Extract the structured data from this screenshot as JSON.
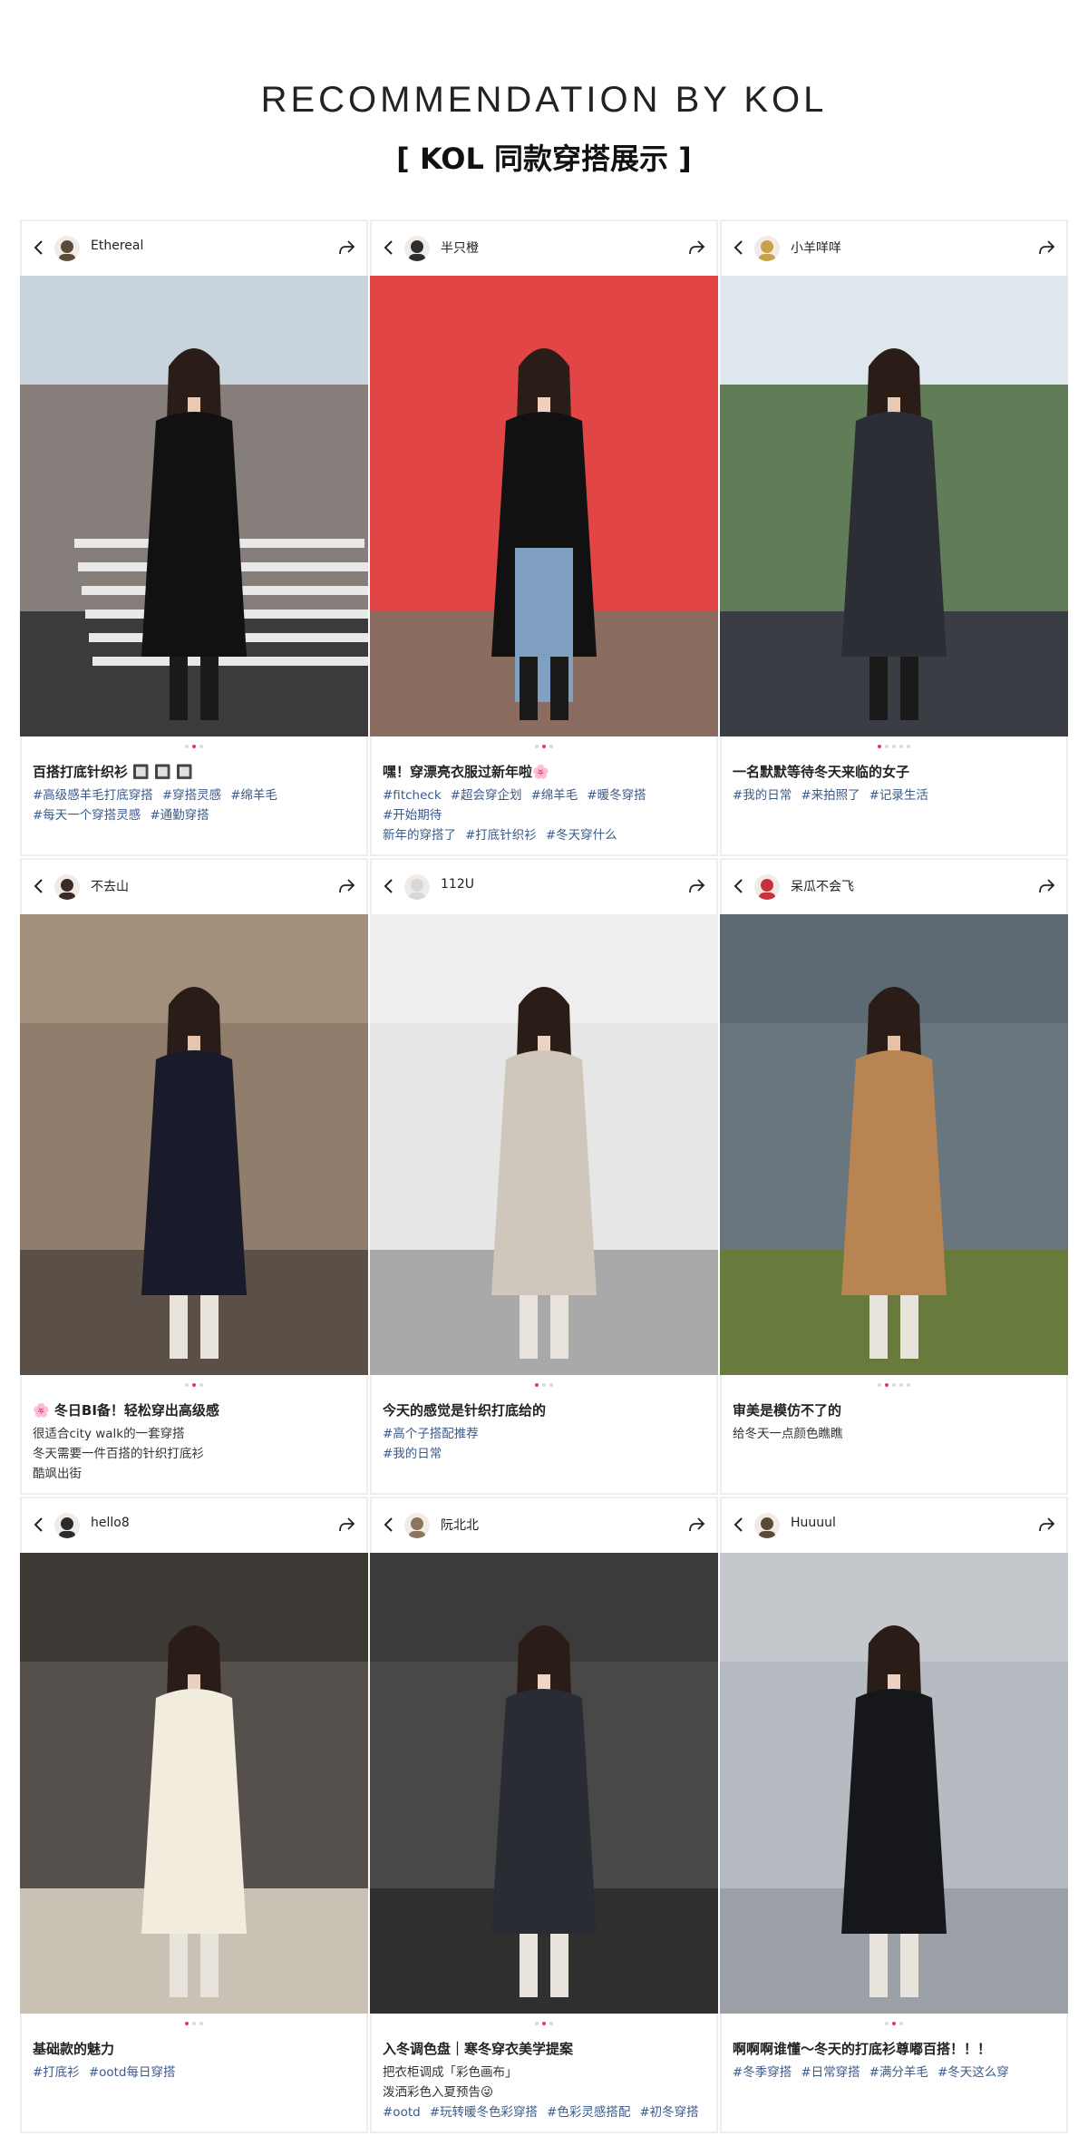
{
  "header": {
    "title_en": "RECOMMENDATION BY KOL",
    "title_cn": "[ KOL 同款穿搭展示 ]"
  },
  "colors": {
    "tag": "#3a5a8a",
    "dot_active": "#e23b56",
    "dot_inactive": "#d9d9d9"
  },
  "cards": [
    {
      "user": "Ethereal",
      "title": "百搭打底针织衫 🔲 🔲 🔲",
      "lines": [],
      "tags": [
        [
          "#高级感羊毛打底穿搭",
          "#穿搭灵感",
          "#绵羊毛"
        ],
        [
          "#每天一个穿搭灵感",
          "#通勤穿搭"
        ]
      ]
    },
    {
      "user": "半只橙",
      "title": "嘿！穿漂亮衣服过新年啦🌸",
      "lines": [],
      "tags": [
        [
          "#fitcheck",
          "#超会穿企划",
          "#绵羊毛",
          "#暖冬穿搭",
          "#开始期待"
        ],
        [
          "新年的穿搭了",
          "#打底针织衫",
          "#冬天穿什么"
        ]
      ]
    },
    {
      "user": "小羊咩咩",
      "title": "一名默默等待冬天来临的女子",
      "lines": [],
      "tags": [
        [
          "#我的日常",
          "#来拍照了",
          "#记录生活"
        ]
      ]
    },
    {
      "user": "不去山",
      "title": "🌸 冬日BI备！轻松穿出高级感",
      "lines": [
        "很适合city walk的一套穿搭",
        "冬天需要一件百搭的针织打底衫",
        "酷飒出街"
      ],
      "tags": []
    },
    {
      "user": "112U",
      "title": "今天的感觉是针织打底给的",
      "lines": [],
      "tags": [
        [
          "#高个子搭配推荐"
        ],
        [
          "#我的日常"
        ]
      ]
    },
    {
      "user": "呆瓜不会飞",
      "title": "审美是模仿不了的",
      "lines": [
        "给冬天一点颜色瞧瞧"
      ],
      "tags": []
    },
    {
      "user": "hello8",
      "title": "基础款的魅力",
      "lines": [],
      "tags": [
        [
          "#打底衫",
          "#ootd每日穿搭"
        ]
      ]
    },
    {
      "user": "阮北北",
      "title": "入冬调色盘｜寒冬穿衣美学提案",
      "lines": [
        "把衣柜调成「彩色画布」",
        "泼洒彩色入夏预告😜"
      ],
      "tags": [
        [
          "#ootd",
          "#玩转暖冬色彩穿搭",
          "#色彩灵感搭配",
          "#初冬穿搭"
        ]
      ]
    },
    {
      "user": "Huuuul",
      "title": "啊啊啊谁懂～冬天的打底衫尊嘟百搭！！！",
      "lines": [],
      "tags": [
        [
          "#冬季穿搭",
          "#日常穿搭",
          "#满分羊毛",
          "#冬天这么穿"
        ]
      ]
    }
  ]
}
